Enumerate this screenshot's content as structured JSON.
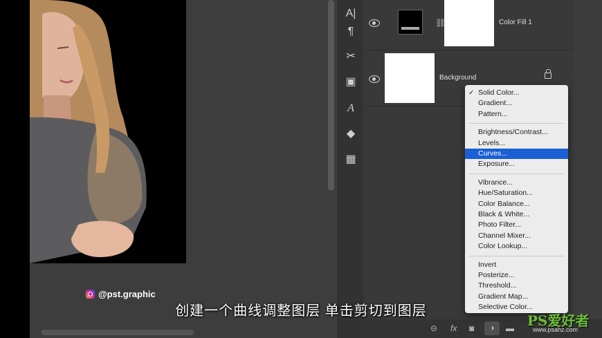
{
  "layers": [
    {
      "name": "Color Fill 1"
    },
    {
      "name": "Background"
    }
  ],
  "menu": {
    "groups": [
      [
        {
          "label": "Solid Color...",
          "checked": true
        },
        {
          "label": "Gradient..."
        },
        {
          "label": "Pattern..."
        }
      ],
      [
        {
          "label": "Brightness/Contrast..."
        },
        {
          "label": "Levels..."
        },
        {
          "label": "Curves...",
          "highlighted": true
        },
        {
          "label": "Exposure..."
        }
      ],
      [
        {
          "label": "Vibrance..."
        },
        {
          "label": "Hue/Saturation..."
        },
        {
          "label": "Color Balance..."
        },
        {
          "label": "Black & White..."
        },
        {
          "label": "Photo Filter..."
        },
        {
          "label": "Channel Mixer..."
        },
        {
          "label": "Color Lookup..."
        }
      ],
      [
        {
          "label": "Invert"
        },
        {
          "label": "Posterize..."
        },
        {
          "label": "Threshold..."
        },
        {
          "label": "Gradient Map..."
        },
        {
          "label": "Selective Color..."
        }
      ]
    ]
  },
  "bottom_bar": {
    "fx_label": "fx"
  },
  "overlay": {
    "subtitle": "创建一个曲线调整图层 单击剪切到图层",
    "handle": "@pst.graphic",
    "watermark_text": "PS爱好者",
    "watermark_url": "www.psahz.com"
  },
  "tools": [
    "paragraph-char-icon",
    "pilcrow-icon",
    "scissors-tools-icon",
    "frame-icon",
    "glyph-a-icon",
    "shape-icon",
    "grid-icon"
  ],
  "colors": {
    "highlight": "#1a5fd4",
    "panel": "#393939",
    "canvas": "#3d3d3d"
  }
}
